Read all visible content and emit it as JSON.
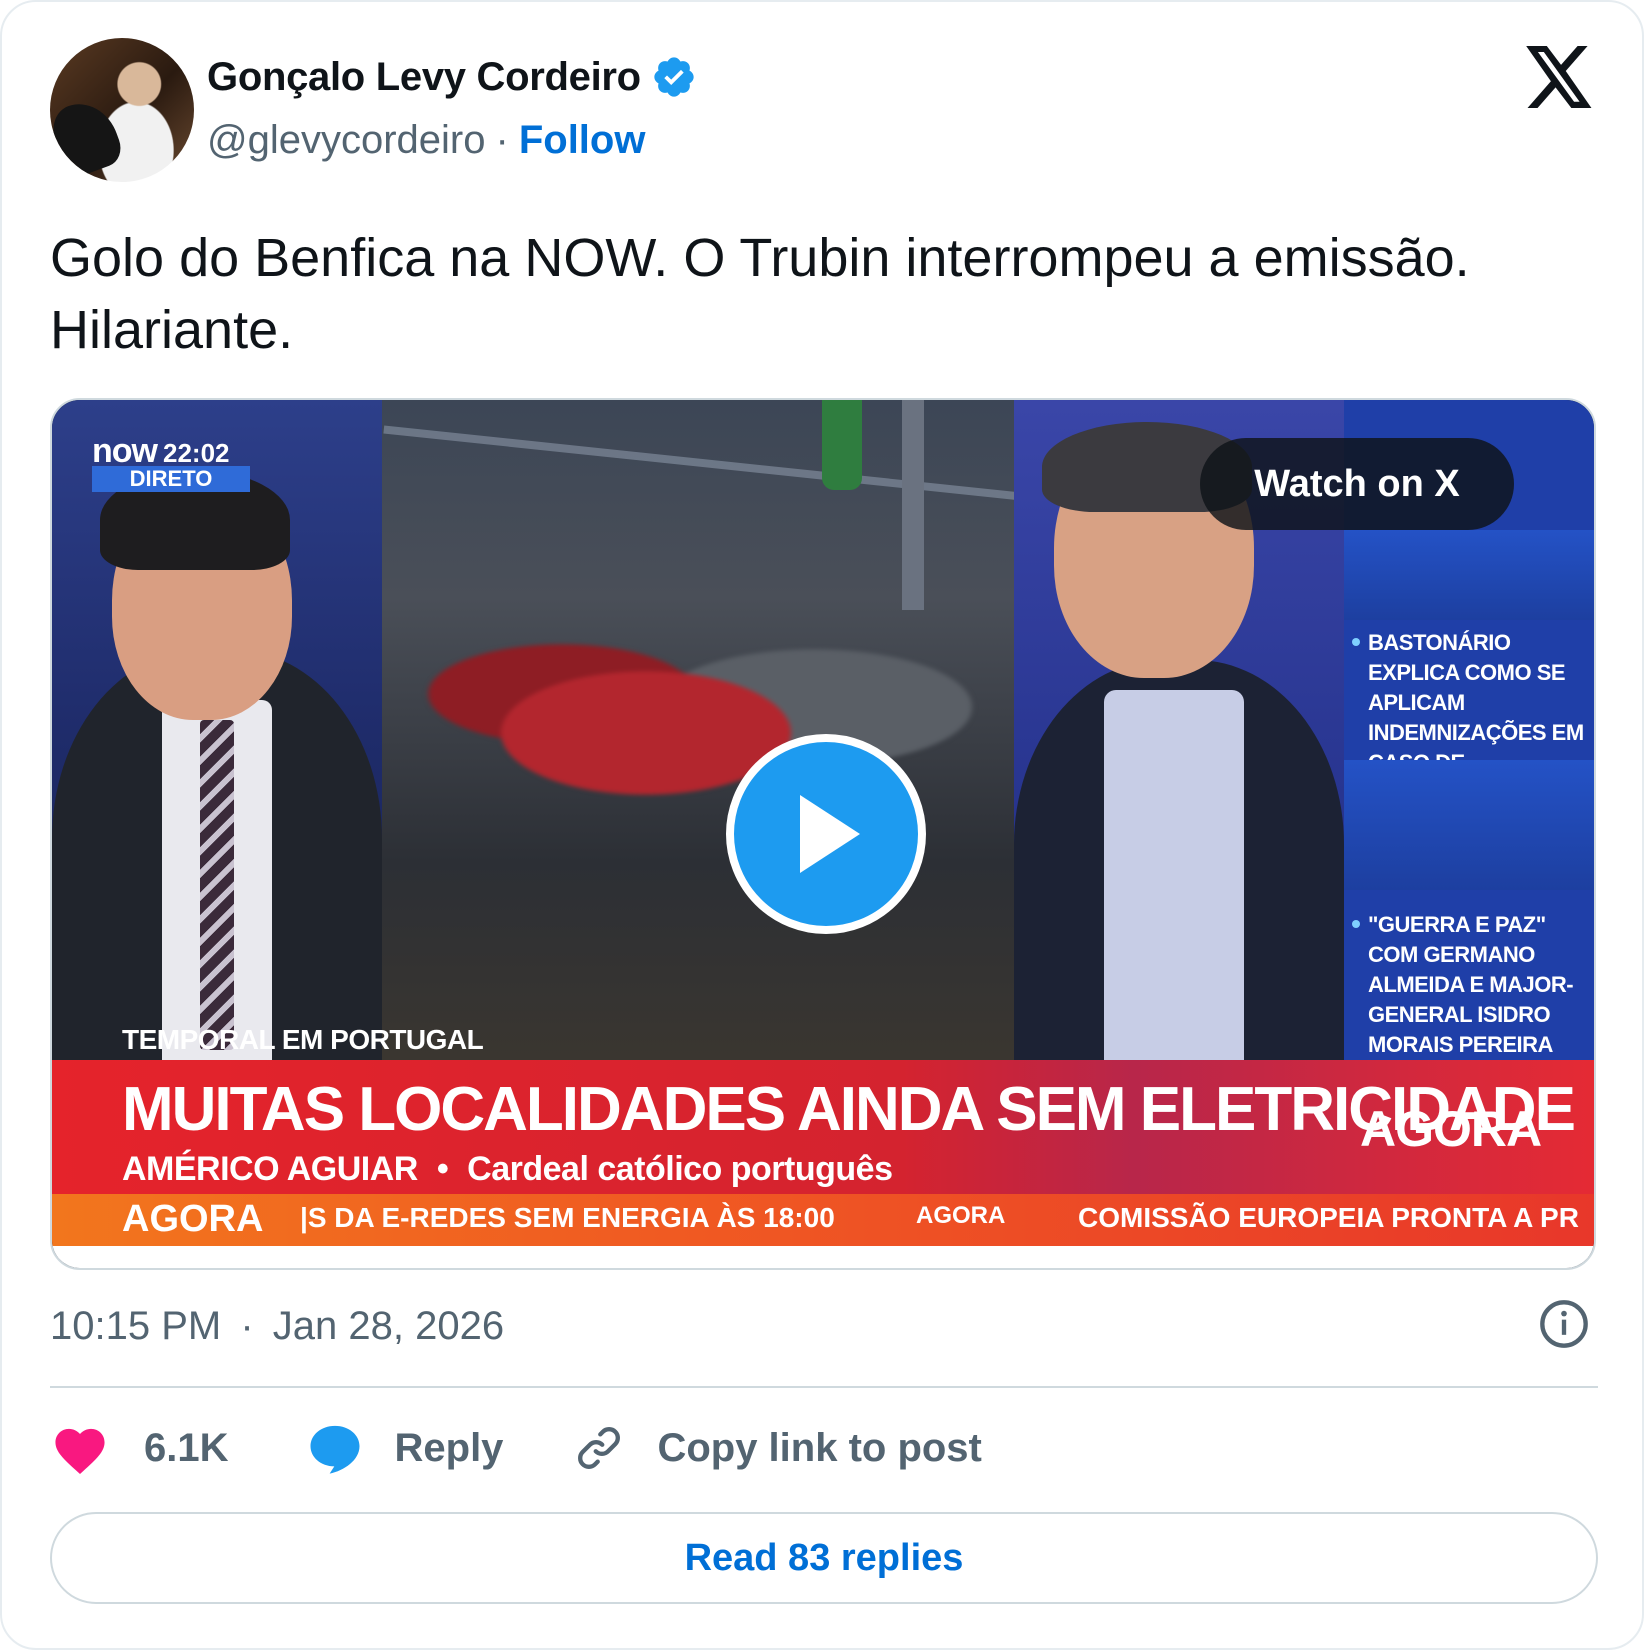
{
  "author": {
    "name": "Gonçalo Levy Cordeiro",
    "handle": "@glevycordeiro",
    "separator": "·",
    "follow_label": "Follow"
  },
  "tweet": {
    "text": "Golo do Benfica na NOW. O Trubin interrompeu a emissão. Hilariante."
  },
  "media": {
    "channel_logo": "now",
    "clock": "22:02",
    "live_label": "DIRETO",
    "watch_label": "Watch on X",
    "side_items": [
      "BASTONÁRIO EXPLICA COMO SE APLICAM INDEMNIZAÇÕES EM CASO DE TEMPESTADE",
      "\"GUERRA E PAZ\" COM GERMANO ALMEIDA E MAJOR-GENERAL ISIDRO MORAIS PEREIRA"
    ],
    "topic": "TEMPORAL EM PORTUGAL",
    "headline": "MUITAS LOCALIDADES AINDA SEM ELETRICIDADE",
    "guest_name": "AMÉRICO AGUIAR",
    "guest_sep": "•",
    "guest_role": "Cardeal católico português",
    "brand": "AGORA",
    "ticker_brand": "AGORA",
    "ticker_1": "|S DA E-REDES SEM ENERGIA ÀS 18:00",
    "ticker_brand_2": "AGORA",
    "ticker_2": "COMISSÃO EUROPEIA PRONTA A PR"
  },
  "footer": {
    "time": "10:15 PM",
    "separator": "·",
    "date": "Jan 28, 2026",
    "like_count": "6.1K",
    "reply_label": "Reply",
    "copy_label": "Copy link to post",
    "read_replies_label": "Read 83 replies"
  },
  "colors": {
    "link_blue": "#006fd6",
    "verified_blue": "#1d9bf0",
    "heart_pink": "#f91880",
    "secondary_text": "#536471"
  },
  "icons": [
    "verified-badge-icon",
    "x-logo-icon",
    "play-icon",
    "info-icon",
    "heart-icon",
    "reply-bubble-icon",
    "link-icon"
  ]
}
